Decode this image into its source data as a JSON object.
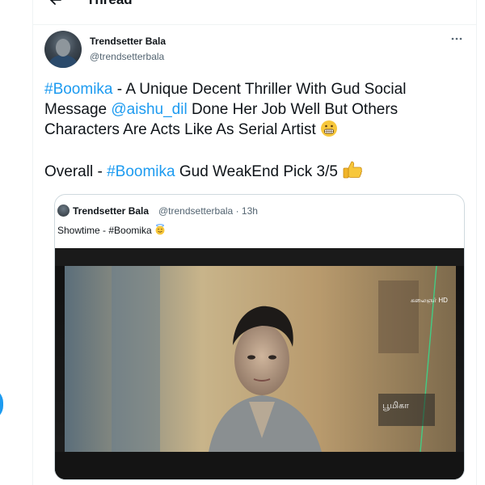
{
  "header": {
    "title": "Thread",
    "back_icon": "arrow-left-icon"
  },
  "tweet": {
    "display_name": "Trendsetter Bala",
    "handle": "@trendsetterbala",
    "more_icon": "ellipsis-icon",
    "line1_hashtag": "#Boomika",
    "line1_text": " - A Unique Decent Thriller With Gud Social Message ",
    "mention": "@aishu_dil",
    "line1_rest": " Done Her Job Well But Others Characters Are Acts Like As Serial Artist ",
    "emoji1": "grimacing-face-emoji",
    "line2_prefix": "Overall - ",
    "line2_hashtag": "#Boomika",
    "line2_text": " Gud WeakEnd Pick 3/5 ",
    "emoji2": "thumbs-up-emoji"
  },
  "quoted": {
    "display_name": "Trendsetter Bala",
    "handle": "@trendsetterbala",
    "separator": " · ",
    "time": "13h",
    "text": "Showtime - #Boomika ",
    "emoji": "smiling-face-with-halo-emoji",
    "tv_logo_top": "கலைஞர் HD",
    "tv_logo_bottom": "பூமிகா"
  },
  "colors": {
    "accent": "#1d9bf0",
    "text": "#0f1419",
    "muted": "#536471",
    "border": "#cfd9de"
  }
}
